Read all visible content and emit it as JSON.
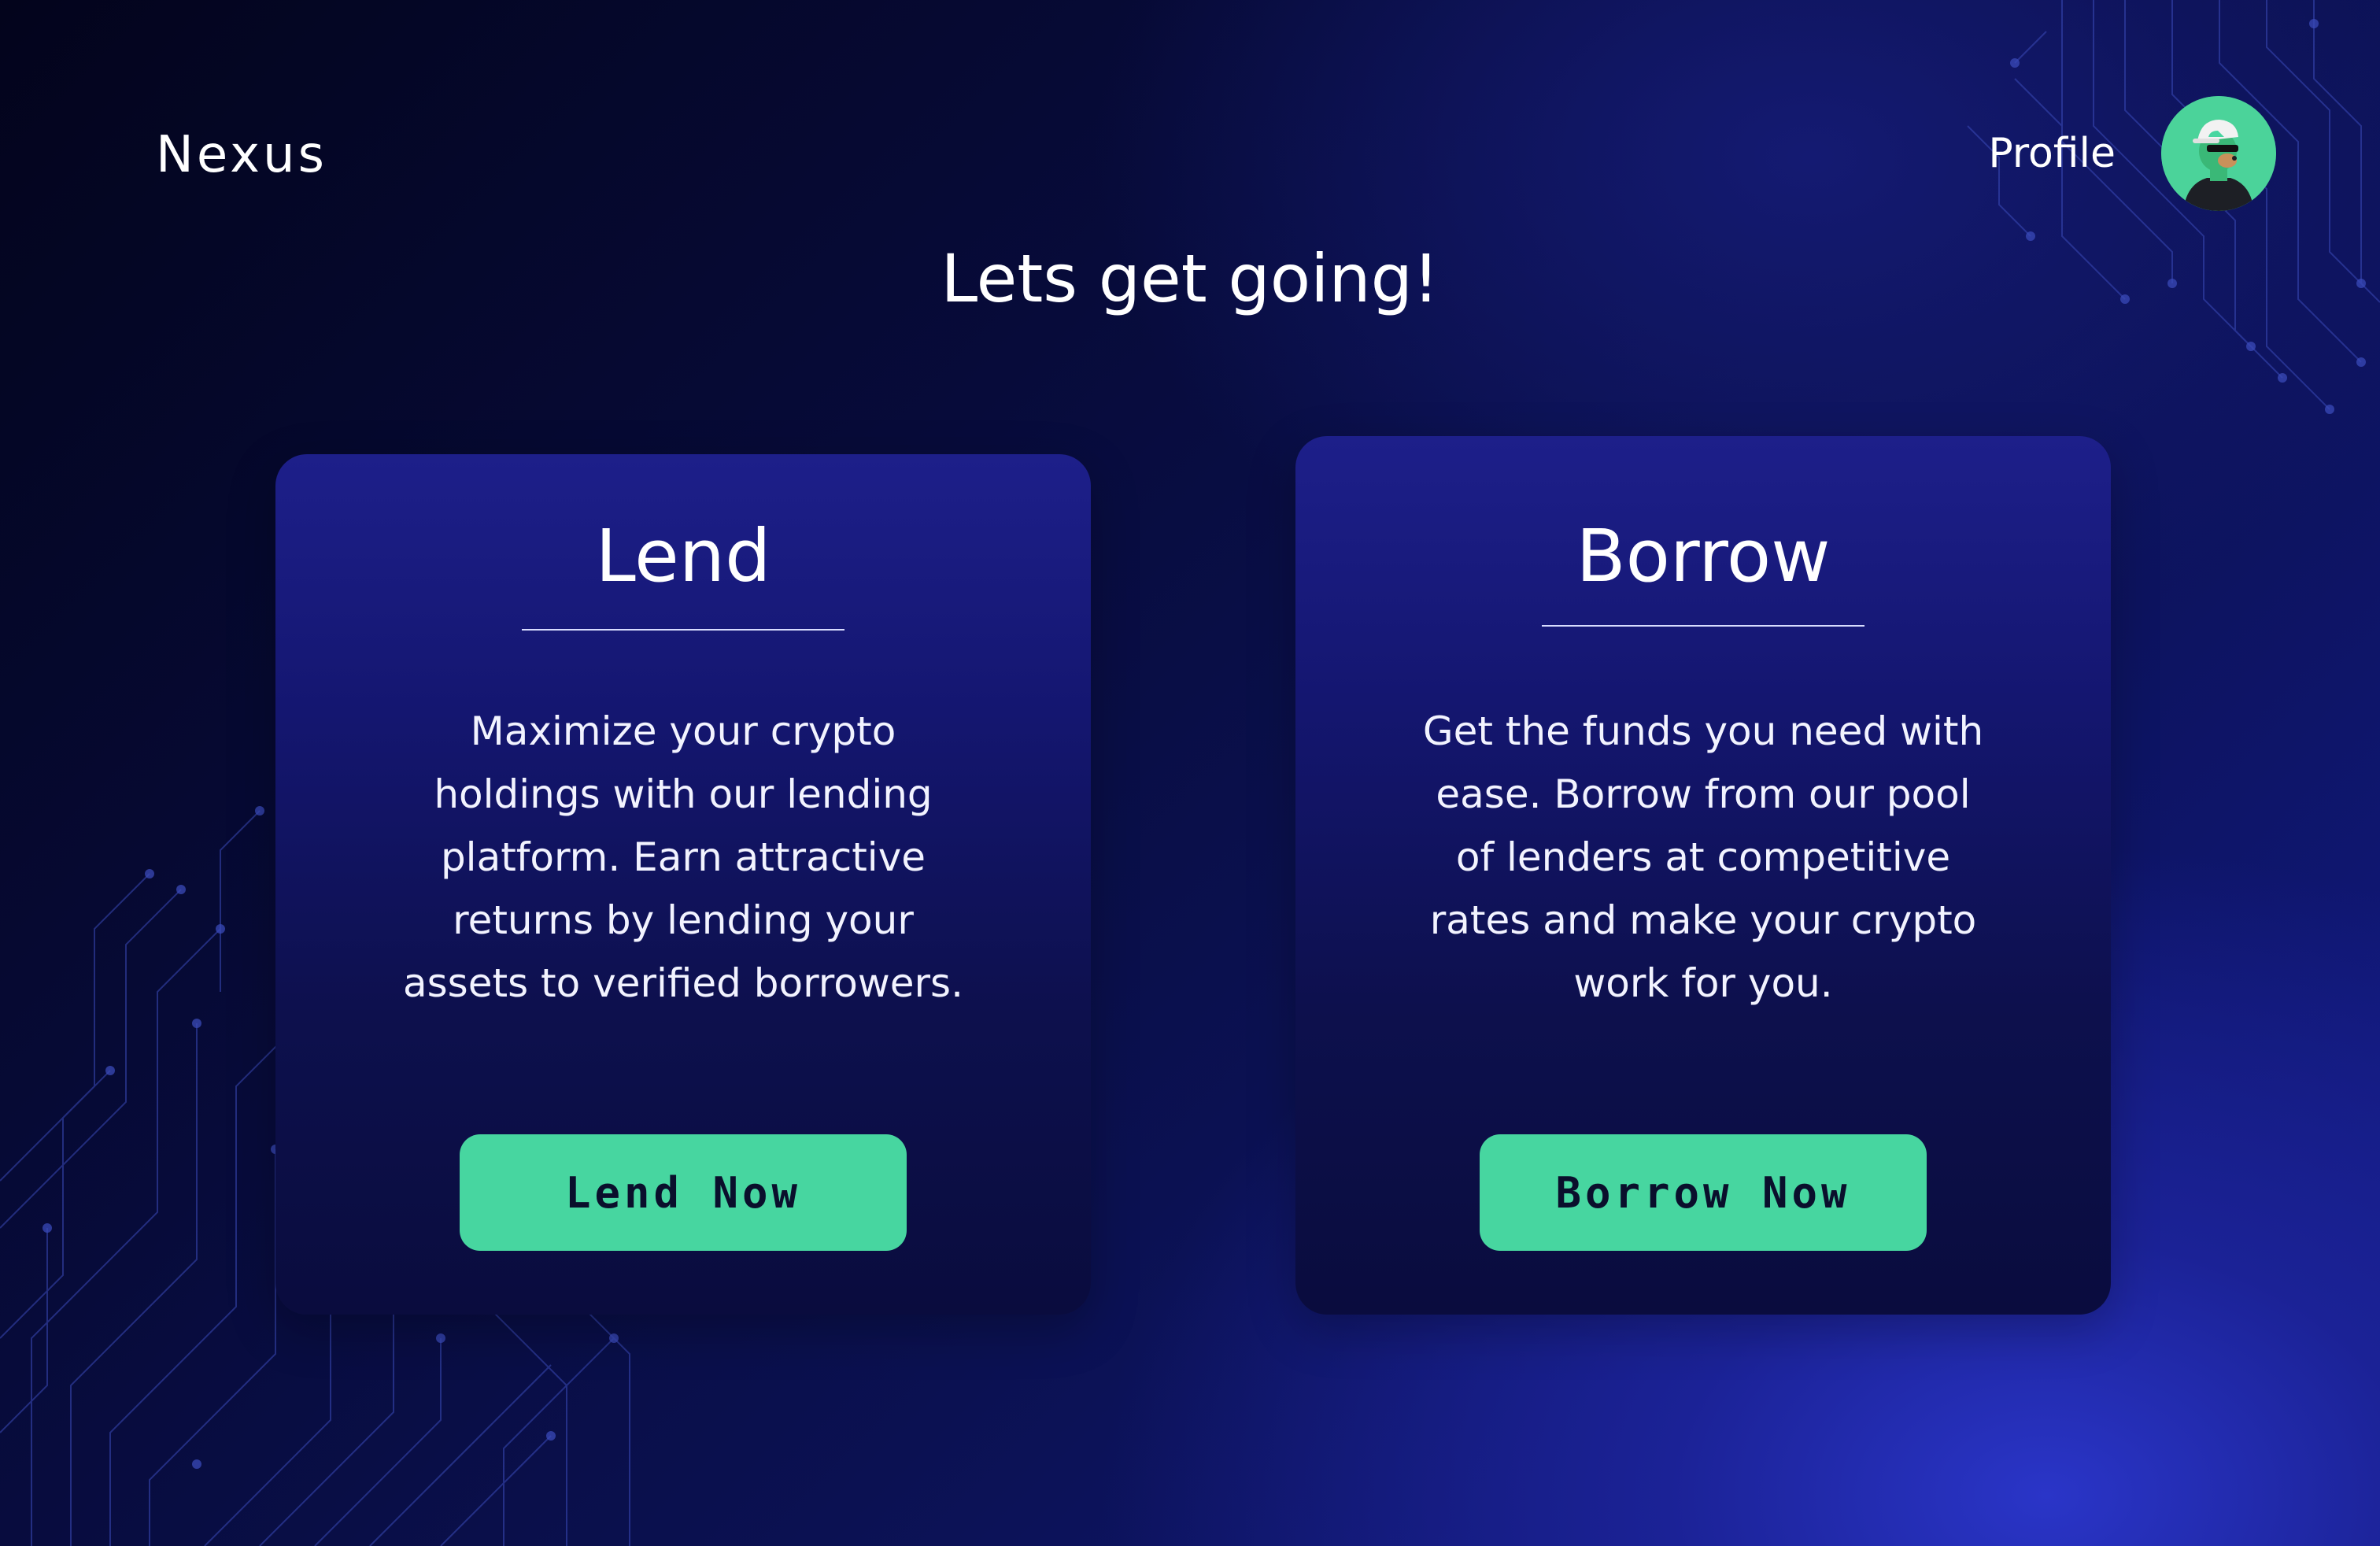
{
  "brand": {
    "name": "Nexus"
  },
  "header": {
    "profile_label": "Profile",
    "avatar_icon": "avatar-icon"
  },
  "main": {
    "headline": "Lets get going!"
  },
  "cards": [
    {
      "title": "Lend",
      "description": "Maximize your crypto holdings with our lending platform. Earn attractive returns by lending your assets to verified borrowers.",
      "button_label": "Lend Now"
    },
    {
      "title": "Borrow",
      "description": "Get the funds you need with ease. Borrow from our pool of lenders at competitive rates and make your crypto work for you.",
      "button_label": "Borrow Now"
    }
  ],
  "colors": {
    "accent": "#47d6a0",
    "background_dark": "#03041c",
    "background_glow": "#2a35c8",
    "card": "#141670"
  }
}
